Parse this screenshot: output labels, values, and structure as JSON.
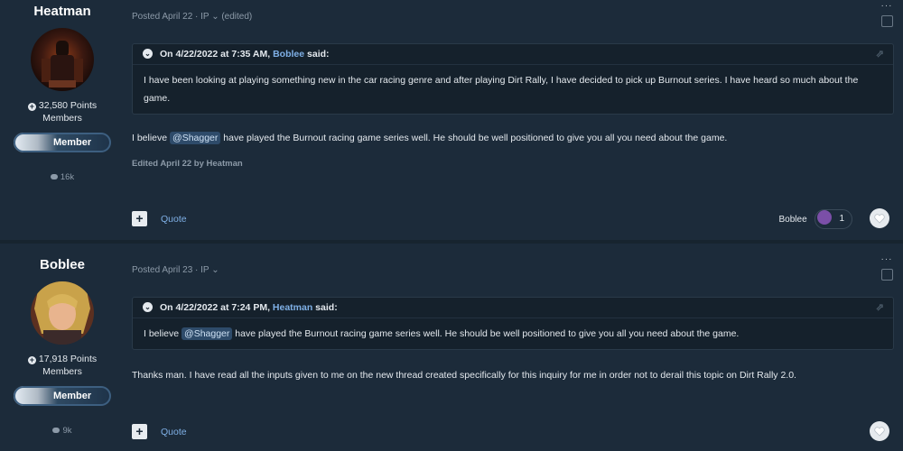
{
  "posts": [
    {
      "author": {
        "name": "Heatman",
        "points": "32,580 Points",
        "group": "Members",
        "badge": "Member",
        "reputation": "16k"
      },
      "meta": "Posted April 22 · IP ⌄ (edited)",
      "quote": {
        "header_prefix": "On 4/22/2022 at 7:35 AM, ",
        "header_author": "Boblee",
        "header_suffix": " said:",
        "body": "I have been looking at playing something new in the car racing genre and after playing Dirt Rally, I have decided to pick up Burnout series. I have heard so much about the game."
      },
      "text_prefix": "I believe ",
      "mention": "@Shagger",
      "text_suffix": " have played the Burnout racing game series well. He should be well positioned to give you all you need about the game.",
      "edited": "Edited April 22 by Heatman",
      "quote_label": "Quote",
      "reaction": {
        "user": "Boblee",
        "count": "1"
      }
    },
    {
      "author": {
        "name": "Boblee",
        "points": "17,918 Points",
        "group": "Members",
        "badge": "Member",
        "reputation": "9k"
      },
      "meta": "Posted April 23 · IP ⌄",
      "quote": {
        "header_prefix": "On 4/22/2022 at 7:24 PM, ",
        "header_author": "Heatman",
        "header_suffix": " said:",
        "body_prefix": "I believe ",
        "body_mention": "@Shagger",
        "body_suffix": " have played the Burnout racing game series well. He should be well positioned to give you all you need about the game."
      },
      "text": "Thanks man. I have read all the inputs given to me on the new thread created specifically for this inquiry for me in order not to derail this topic on Dirt Rally 2.0.",
      "quote_label": "Quote"
    }
  ],
  "icons": {
    "plus": "+",
    "toggle": "⌄",
    "dots": "···",
    "share": "⇗"
  }
}
